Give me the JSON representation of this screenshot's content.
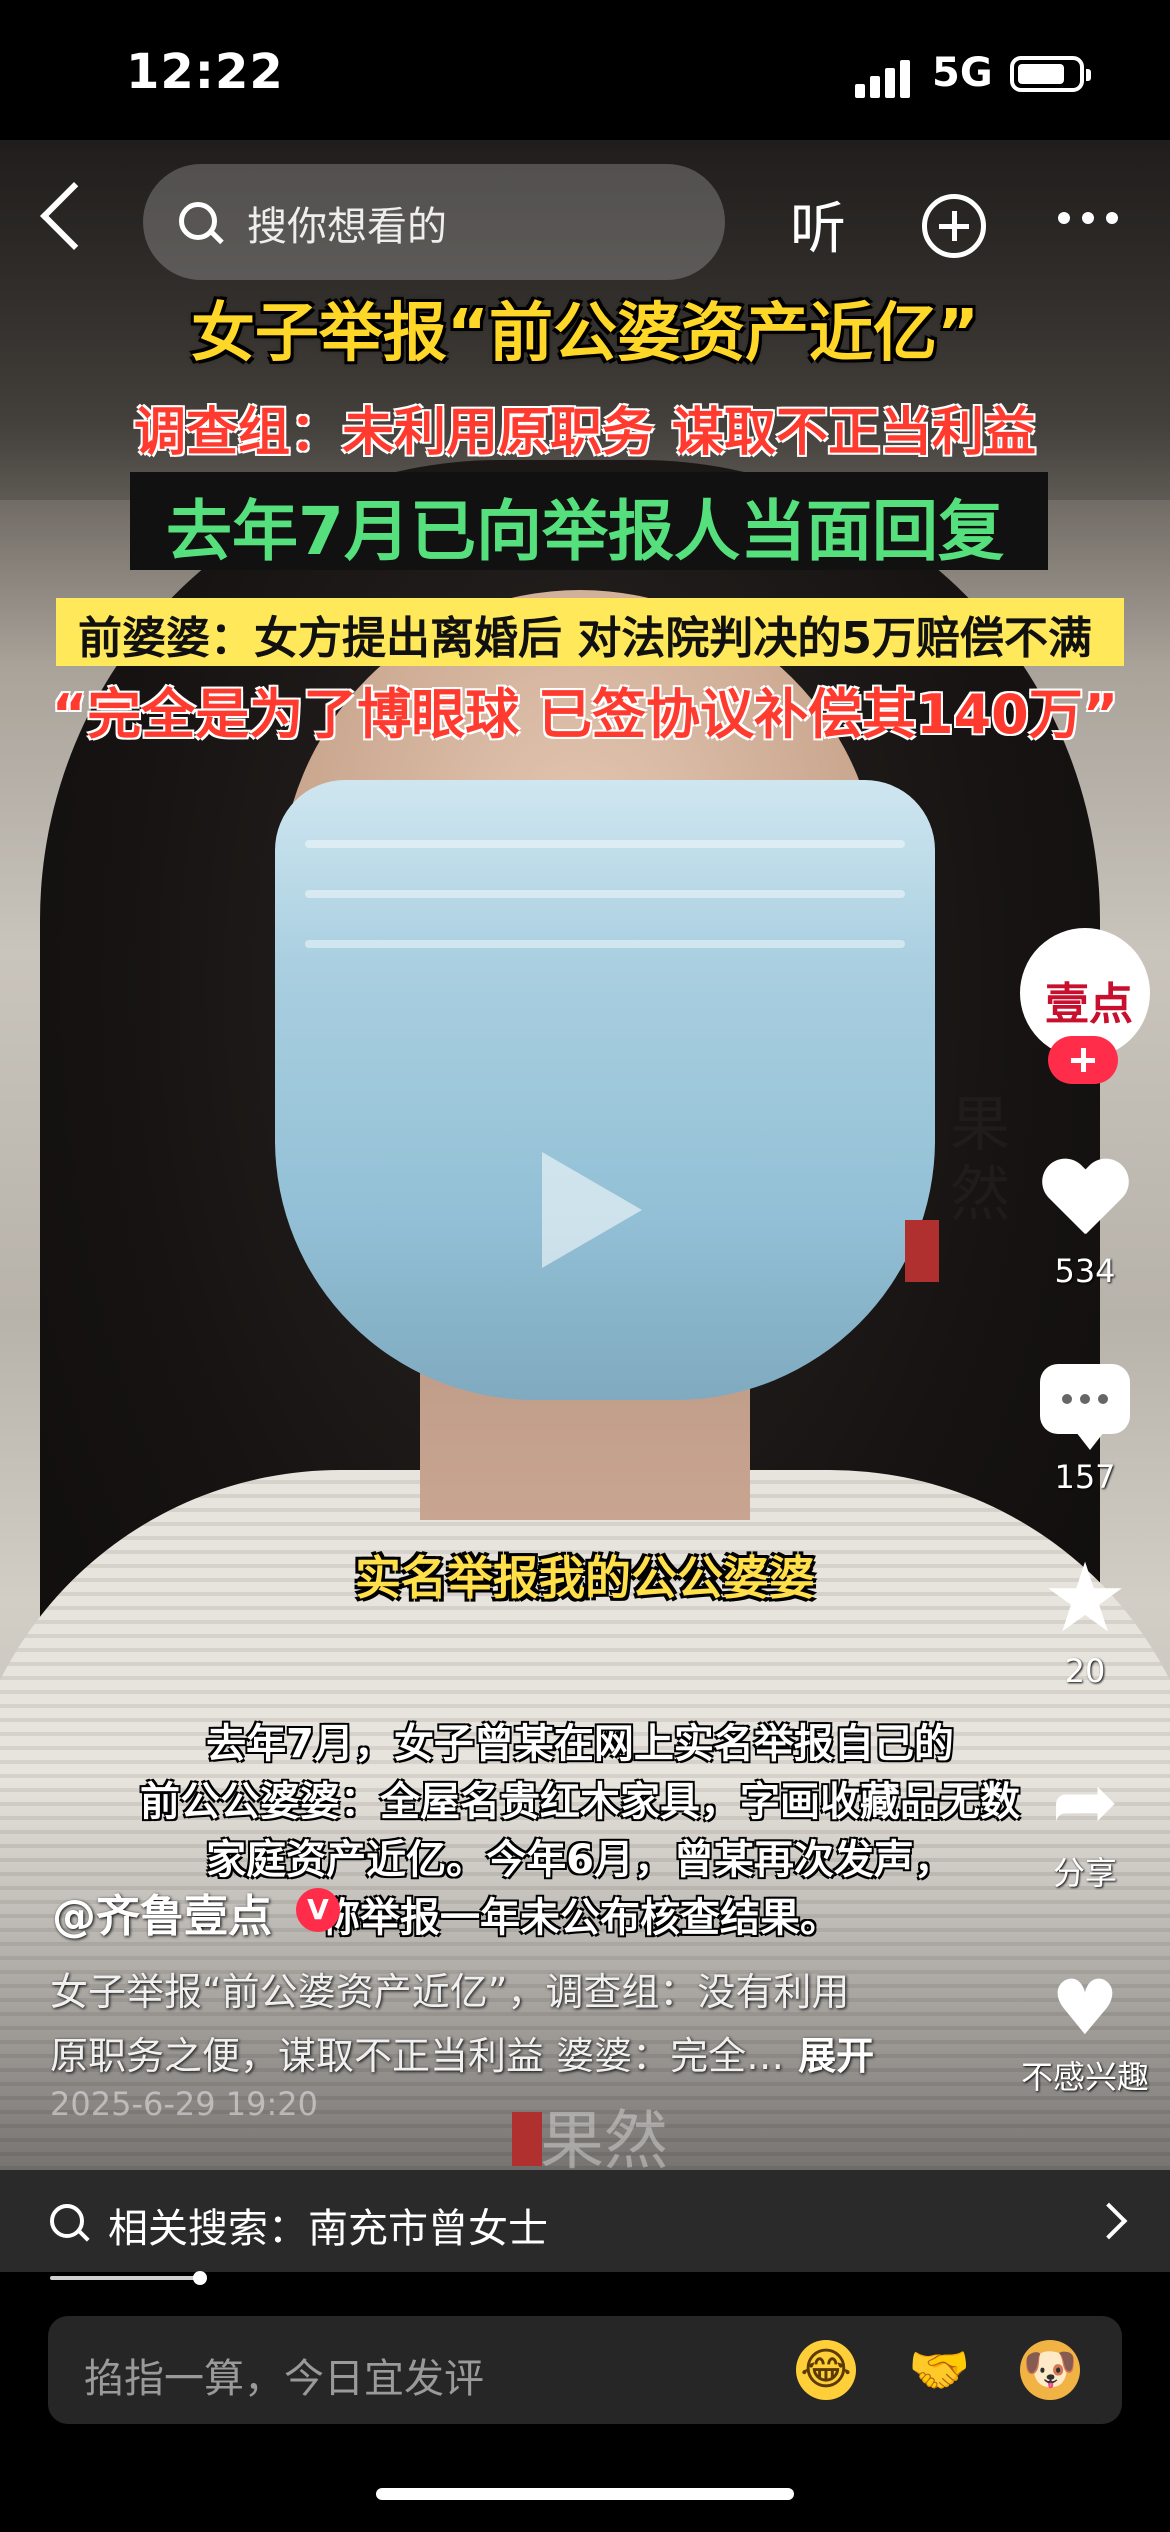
{
  "status": {
    "time": "12:22",
    "network": "5G"
  },
  "nav": {
    "search_placeholder": "搜你想看的",
    "listen": "听"
  },
  "video": {
    "headline1": "女子举报“前公婆资产近亿”",
    "headline2": "调查组：未利用原职务 谋取不正当利益",
    "headline3": "去年7月已向举报人当面回复",
    "headline4": "前婆婆：女方提出离婚后 对法院判决的5万赔偿不满",
    "headline5": "“完全是为了博眼球 已签协议补偿其140万”",
    "watermark": "果然",
    "subtitle": "实名举报我的公公婆婆",
    "caption": [
      "去年7月，女子曾某在网上实名举报自己的",
      "前公公婆婆：全屋名贵红木家具，字画收藏品无数",
      "家庭资产近亿。今年6月，曾某再次发声，",
      "称举报一年未公布核查结果。"
    ],
    "watermark2": "果然"
  },
  "sidebar": {
    "avatar_logo": "壹点",
    "likes": "534",
    "comments": "157",
    "favorites": "20",
    "share_label": "分享",
    "dislike_label": "不感兴趣"
  },
  "post": {
    "author": "@齐鲁壹点",
    "verified_badge": "V",
    "desc_line1": "女子举报“前公婆资产近亿”，调查组：没有利用",
    "desc_line2": "原职务之便，谋取不正当利益 婆婆：完全…",
    "expand": "展开",
    "date": "2025-6-29 19:20"
  },
  "related": {
    "text": "相关搜索：南充市曾女士"
  },
  "comment": {
    "placeholder": "掐指一算，今日宜发评"
  },
  "icons": [
    "back-icon",
    "search-icon",
    "plus-icon",
    "more-icon",
    "heart-icon",
    "comment-icon",
    "star-icon",
    "share-icon",
    "broken-heart-icon",
    "chevron-right-icon"
  ]
}
